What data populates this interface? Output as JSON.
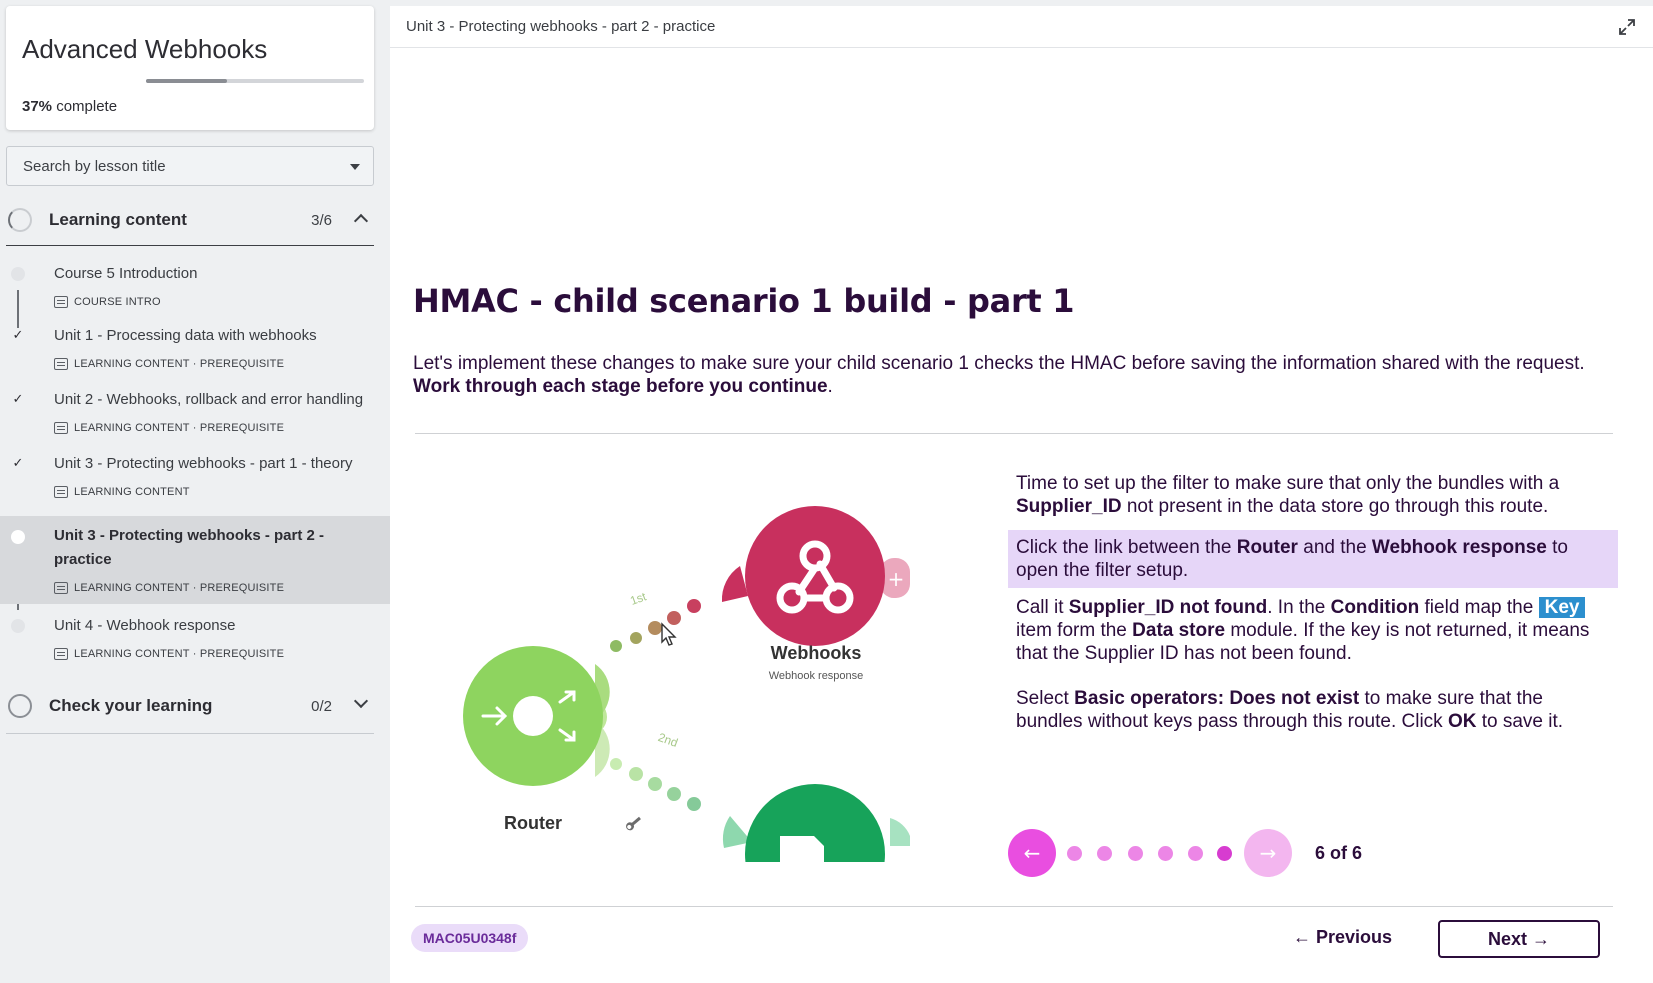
{
  "course": {
    "title": "Advanced Webhooks",
    "progress_percent": 37,
    "progress_value": "37%",
    "progress_suffix": "complete"
  },
  "search": {
    "placeholder": "Search by lesson title"
  },
  "sections": [
    {
      "label": "Learning content",
      "count": "3/6",
      "expanded": true,
      "lessons": [
        {
          "title": "Course 5 Introduction",
          "meta": "COURSE INTRO",
          "status": "not-started"
        },
        {
          "title": "Unit 1 - Processing data with webhooks",
          "meta": "LEARNING CONTENT · PREREQUISITE",
          "status": "complete"
        },
        {
          "title": "Unit 2 - Webhooks, rollback and error handling",
          "meta": "LEARNING CONTENT · PREREQUISITE",
          "status": "complete"
        },
        {
          "title": "Unit 3 - Protecting webhooks - part 1 - theory",
          "meta": "LEARNING CONTENT",
          "status": "complete"
        },
        {
          "title": "Unit 3 - Protecting webhooks - part 2 - practice",
          "meta": "LEARNING CONTENT · PREREQUISITE",
          "status": "current"
        },
        {
          "title": "Unit 4 - Webhook response",
          "meta": "LEARNING CONTENT · PREREQUISITE",
          "status": "not-started"
        }
      ]
    },
    {
      "label": "Check your learning",
      "count": "0/2",
      "expanded": false
    }
  ],
  "topbar": {
    "title": "Unit 3 - Protecting webhooks - part 2 - practice"
  },
  "lesson": {
    "heading": "HMAC - child scenario 1 build - part 1",
    "intro_text": "Let's implement these changes to make sure your child scenario 1 checks the HMAC before saving the information shared with the request. ",
    "intro_bold": "Work through each stage before you continue",
    "intro_end": "."
  },
  "diagram": {
    "webhooks_label": "Webhooks",
    "webhooks_sub": "Webhook response",
    "router_label": "Router",
    "route1": "1st",
    "route2": "2nd",
    "colors": {
      "router": "#8ed45f",
      "webhooks": "#c8305e",
      "datastore": "#17a35a"
    }
  },
  "steps": {
    "s1": {
      "a": "Time to set up the filter to make sure that only the bundles with a ",
      "b": "Supplier_ID",
      "c": " not present in the data store go through this route."
    },
    "s2": {
      "a": "Click the link between the ",
      "b": "Router",
      "c": " and the ",
      "d": "Webhook response",
      "e": " to open the filter setup."
    },
    "s3": {
      "a": "Call it ",
      "b": "Supplier_ID not found",
      "c": ". In the ",
      "d": "Condition",
      "e": " field map the ",
      "key": "Key",
      "f": " item form the ",
      "g": "Data store",
      "h": " module. If the key is not returned, it means that the Supplier ID has not been found."
    },
    "s4": {
      "a": "Select ",
      "b": "Basic operators: Does not exist",
      "c": " to make sure that the bundles without keys pass through this route. Click ",
      "d": "OK",
      "e": " to save it."
    }
  },
  "carousel": {
    "current": 6,
    "total": 6,
    "label": "6 of 6",
    "prev_icon": "←",
    "next_icon": "→"
  },
  "footer": {
    "code": "MAC05U0348f",
    "previous": "Previous",
    "next": "Next"
  },
  "colors": {
    "accent_pink": "#e94ee0",
    "highlight": "#e6d6f8",
    "heading": "#2b0d3b",
    "key_tag": "#2c8fce"
  }
}
